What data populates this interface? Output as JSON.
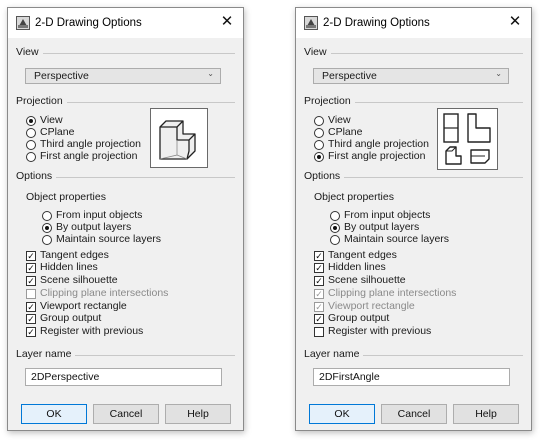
{
  "dialogs": [
    {
      "title": "2-D Drawing Options",
      "view_section": "View",
      "view_value": "Perspective",
      "projection_section": "Projection",
      "projection_options": [
        "View",
        "CPlane",
        "Third angle projection",
        "First angle projection"
      ],
      "projection_selected": "View",
      "options_section": "Options",
      "object_properties_label": "Object properties",
      "object_properties_options": [
        "From input objects",
        "By output layers",
        "Maintain source layers"
      ],
      "object_properties_selected": "By output layers",
      "checkboxes": [
        {
          "label": "Tangent edges",
          "checked": true,
          "enabled": true
        },
        {
          "label": "Hidden lines",
          "checked": true,
          "enabled": true
        },
        {
          "label": "Scene silhouette",
          "checked": true,
          "enabled": true
        },
        {
          "label": "Clipping plane intersections",
          "checked": false,
          "enabled": false
        },
        {
          "label": "Viewport rectangle",
          "checked": true,
          "enabled": true
        },
        {
          "label": "Group output",
          "checked": true,
          "enabled": true
        },
        {
          "label": "Register with previous",
          "checked": true,
          "enabled": true
        }
      ],
      "layer_name_section": "Layer name",
      "layer_name_value": "2DPerspective",
      "ok_label": "OK",
      "cancel_label": "Cancel",
      "help_label": "Help"
    },
    {
      "title": "2-D Drawing Options",
      "view_section": "View",
      "view_value": "Perspective",
      "projection_section": "Projection",
      "projection_options": [
        "View",
        "CPlane",
        "Third angle projection",
        "First angle projection"
      ],
      "projection_selected": "First angle projection",
      "options_section": "Options",
      "object_properties_label": "Object properties",
      "object_properties_options": [
        "From input objects",
        "By output layers",
        "Maintain source layers"
      ],
      "object_properties_selected": "By output layers",
      "checkboxes": [
        {
          "label": "Tangent edges",
          "checked": true,
          "enabled": true
        },
        {
          "label": "Hidden lines",
          "checked": true,
          "enabled": true
        },
        {
          "label": "Scene silhouette",
          "checked": true,
          "enabled": true
        },
        {
          "label": "Clipping plane intersections",
          "checked": true,
          "enabled": false
        },
        {
          "label": "Viewport rectangle",
          "checked": true,
          "enabled": false
        },
        {
          "label": "Group output",
          "checked": true,
          "enabled": true
        },
        {
          "label": "Register with previous",
          "checked": false,
          "enabled": true
        }
      ],
      "layer_name_section": "Layer name",
      "layer_name_value": "2DFirstAngle",
      "ok_label": "OK",
      "cancel_label": "Cancel",
      "help_label": "Help"
    }
  ]
}
